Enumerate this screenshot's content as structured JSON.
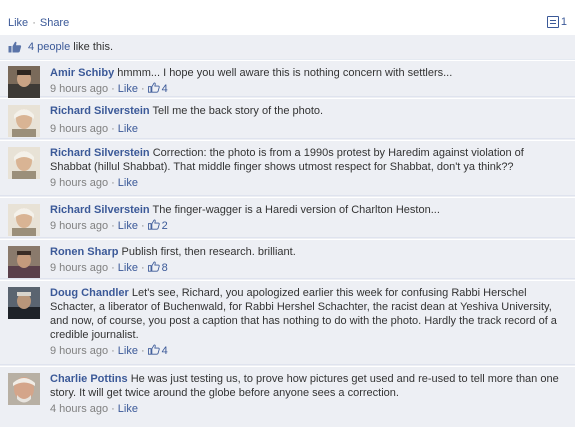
{
  "actions": {
    "like": "Like",
    "separator": "·",
    "share": "Share"
  },
  "comment_icon_count": "1",
  "likes_summary": {
    "count_text": "4 people",
    "rest_text": "like this."
  },
  "comments": [
    {
      "author": "Amir Schiby",
      "text": "hmmm... I hope you well aware this is nothing concern with settlers...",
      "time": "9 hours ago",
      "like": "Like",
      "likes": "4"
    },
    {
      "author": "Richard Silverstein",
      "text": "Tell me the back story of the photo.",
      "time": "9 hours ago",
      "like": "Like",
      "likes": ""
    },
    {
      "author": "Richard Silverstein",
      "text": "Correction: the photo is from a 1990s protest by Haredim against violation of Shabbat (hillul Shabbat). That middle finger shows utmost respect for Shabbat, don't ya think??",
      "time": "9 hours ago",
      "like": "Like",
      "likes": ""
    },
    {
      "author": "Richard Silverstein",
      "text": "The finger-wagger is a Haredi version of Charlton Heston...",
      "time": "9 hours ago",
      "like": "Like",
      "likes": "2"
    },
    {
      "author": "Ronen Sharp",
      "text": "Publish first, then research. brilliant.",
      "time": "9 hours ago",
      "like": "Like",
      "likes": "8"
    },
    {
      "author": "Doug Chandler",
      "text": "Let's see, Richard, you apologized earlier this week for confusing Rabbi Herschel Schacter, a liberator of Buchenwald, for Rabbi Hershel Schachter, the racist dean at Yeshiva University, and now, of course, you post a caption that has nothing to do with the photo. Hardly the track record of a credible journalist.",
      "time": "9 hours ago",
      "like": "Like",
      "likes": "4"
    },
    {
      "author": "Charlie Pottins",
      "text": "He was just testing us, to prove how pictures get used and re-used to tell more than one story. It will get twice around the globe before anyone sees a correction.",
      "time": "4 hours ago",
      "like": "Like",
      "likes": ""
    }
  ]
}
